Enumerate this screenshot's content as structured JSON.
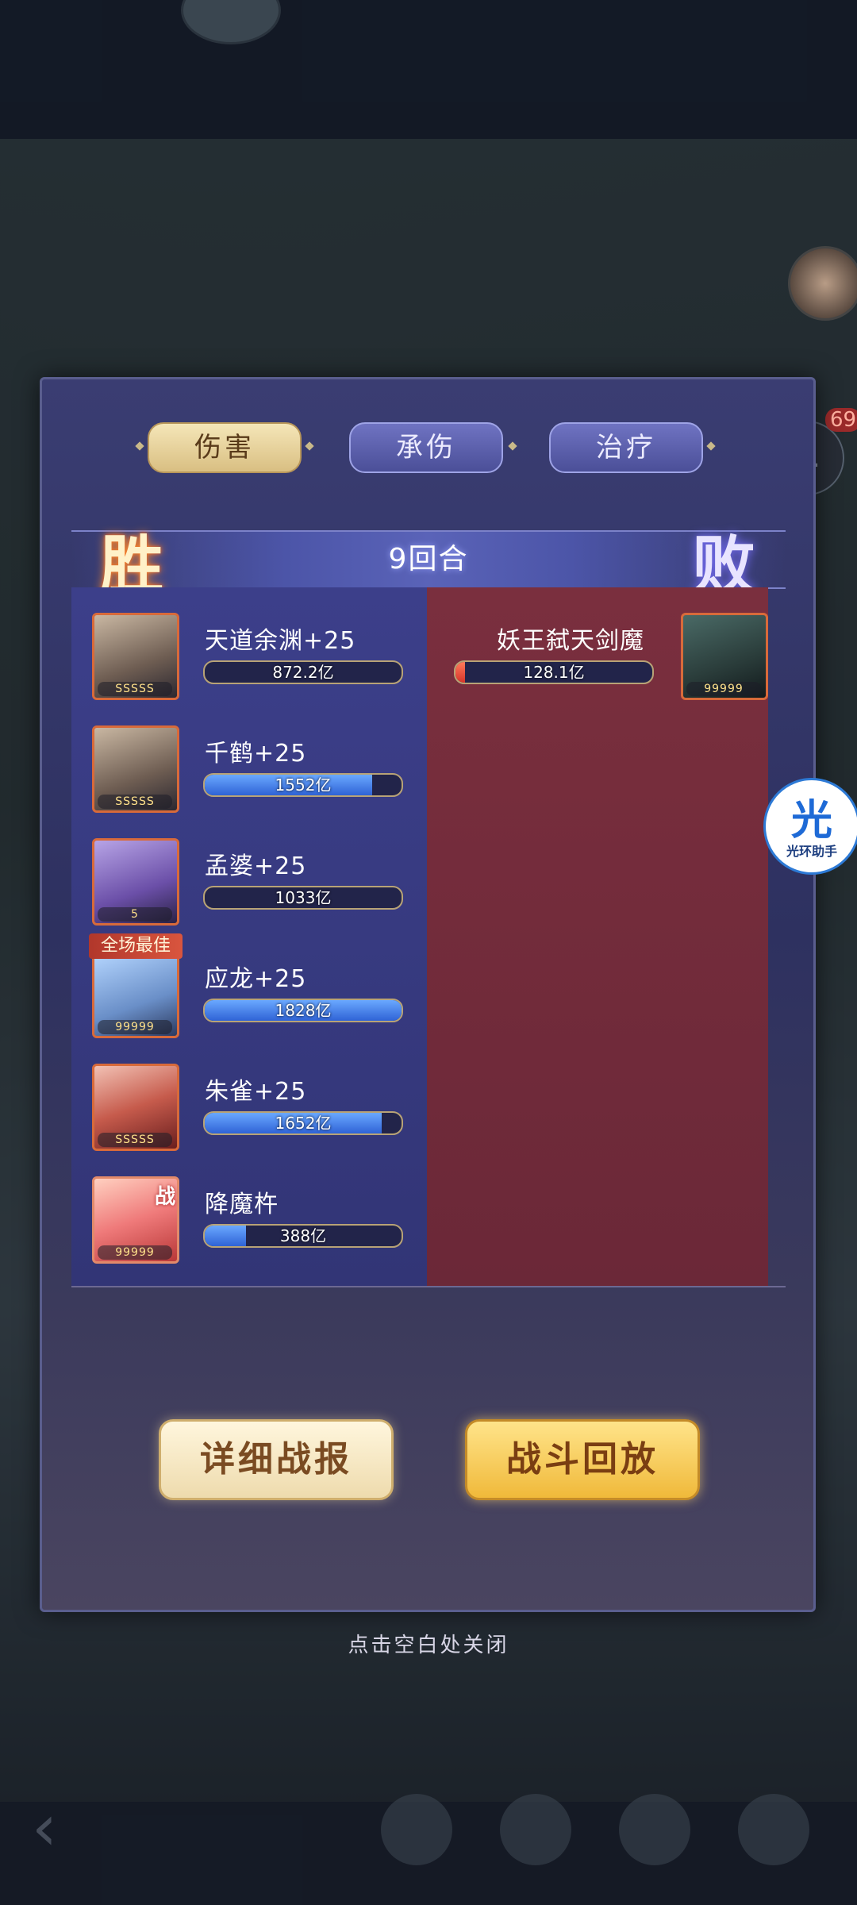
{
  "tabs": [
    {
      "label": "伤害",
      "active": true
    },
    {
      "label": "承伤",
      "active": false
    },
    {
      "label": "治疗",
      "active": false
    }
  ],
  "result": {
    "win_label": "胜",
    "lose_label": "败",
    "rounds": "9回合"
  },
  "allies": [
    {
      "name": "天道余渊+25",
      "damage": "872.2亿",
      "fill": 0.0,
      "stars": "SSSSS"
    },
    {
      "name": "千鹤+25",
      "damage": "1552亿",
      "fill": 0.85,
      "stars": "SSSSS"
    },
    {
      "name": "孟婆+25",
      "damage": "1033亿",
      "fill": 0.0,
      "stars": "5"
    },
    {
      "name": "应龙+25",
      "damage": "1828亿",
      "fill": 1.0,
      "stars": "99999",
      "badge": "全场最佳"
    },
    {
      "name": "朱雀+25",
      "damage": "1652亿",
      "fill": 0.9,
      "stars": "SSSSS"
    },
    {
      "name": "降魔杵",
      "damage": "388亿",
      "fill": 0.21,
      "stars": "99999",
      "tag": "战"
    }
  ],
  "enemies": [
    {
      "name": "妖王弑天剑魔",
      "damage": "128.1亿",
      "fill": 0.05,
      "stars": "99999"
    }
  ],
  "buttons": {
    "detail": "详细战报",
    "replay": "战斗回放"
  },
  "close_hint": "点击空白处关闭",
  "assistant": {
    "glyph": "光",
    "label": "光环助手"
  },
  "notification_count": "69"
}
